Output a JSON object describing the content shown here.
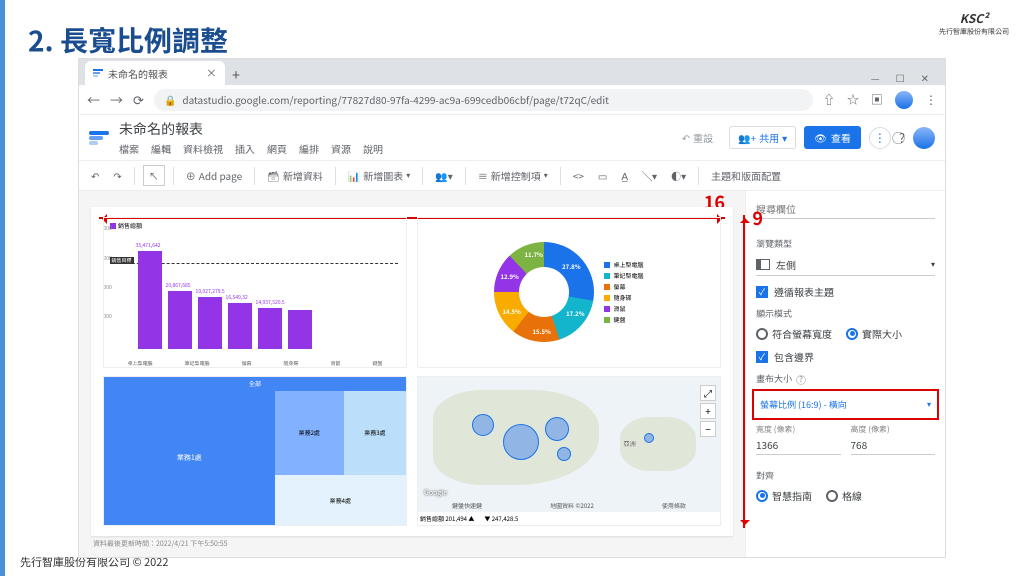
{
  "slide_title": "2. 長寬比例調整",
  "ksc": {
    "main": "KSC²",
    "sub": "先行智庫股份有限公司"
  },
  "footer": "先行智庫股份有限公司 © 2022",
  "browser": {
    "tab_title": "未命名的報表",
    "url": "datastudio.google.com/reporting/77827d80-97fa-4299-ac9a-699cedb06cbf/page/t72qC/edit",
    "win_min": "—",
    "win_max": "☐",
    "win_close": "✕"
  },
  "app": {
    "doc_title": "未命名的報表",
    "menus": [
      "檔案",
      "編輯",
      "資料檢視",
      "插入",
      "網頁",
      "編排",
      "資源",
      "說明"
    ],
    "reset": "重設",
    "share": "共用",
    "view": "查看"
  },
  "toolbar": {
    "undo": "↶",
    "redo": "↷",
    "pointer": "↖",
    "add_page": "Add page",
    "add_data": "新增資料",
    "add_chart": "新增圖表",
    "add_control": "新增控制項",
    "theme": "主題和版面配置"
  },
  "dims": {
    "w": "16",
    "h": "9"
  },
  "chart_data": {
    "bar": {
      "title": "銷售總額",
      "target_label": "銷售目標",
      "target_value": 3000000,
      "y_ticks": [
        "4,000,000",
        "3,000,000",
        "2,000,000",
        "1,000,000",
        "0"
      ],
      "categories": [
        "桌上型電腦",
        "筆記型電腦",
        "螢幕",
        "隨身碟",
        "滑鼠",
        "鍵盤"
      ],
      "values": [
        3547164,
        2086768,
        1902729,
        1654932,
        1493752,
        1430000
      ],
      "labels": [
        "35,471,642",
        "20,867,685",
        "19,027,279.5",
        "16,549,32",
        "14,937,520.5",
        ""
      ]
    },
    "donut": {
      "slices": [
        {
          "label": "桌上型電腦",
          "pct": 27.8,
          "color": "#1a73e8"
        },
        {
          "label": "筆記型電腦",
          "pct": 17.2,
          "color": "#12b5cb"
        },
        {
          "label": "螢幕",
          "pct": 15.5,
          "color": "#e8710a"
        },
        {
          "label": "隨身碟",
          "pct": 14.5,
          "color": "#f9ab00"
        },
        {
          "label": "滑鼠",
          "pct": 12.9,
          "color": "#9334e6"
        },
        {
          "label": "鍵盤",
          "pct": 11.7,
          "color": "#7cb342"
        }
      ]
    },
    "treemap": {
      "header": "全部",
      "items": [
        "業務1處",
        "業務2處",
        "業務3處",
        "業務4處"
      ]
    },
    "map": {
      "credits": [
        "鍵盤快速鍵",
        "地圖資料 ©2022",
        "使用條款"
      ],
      "google": "Google",
      "footer": [
        "銷售總額  201,494 ▲",
        "▼ 247,428.5"
      ],
      "region": "亞洲"
    }
  },
  "canvas_footer_ts": "資料最後更新時間：2022/4/21 下午5:50:55",
  "panel": {
    "search_ph": "搜尋欄位",
    "nav_type_label": "瀏覽類型",
    "nav_type_value": "左側",
    "follow_theme": "遵循報表主題",
    "display_mode": "顯示模式",
    "fit_screen": "符合螢幕寬度",
    "actual_size": "實際大小",
    "include_bounds": "包含邊界",
    "canvas_size_label": "畫布大小",
    "aspect_value": "螢幕比例 (16:9) - 橫向",
    "width_label": "寬度 (像素)",
    "width_val": "1366",
    "height_label": "高度 (像素)",
    "height_val": "768",
    "align_label": "對齊",
    "smart_guide": "智慧指南",
    "grid": "格線"
  }
}
